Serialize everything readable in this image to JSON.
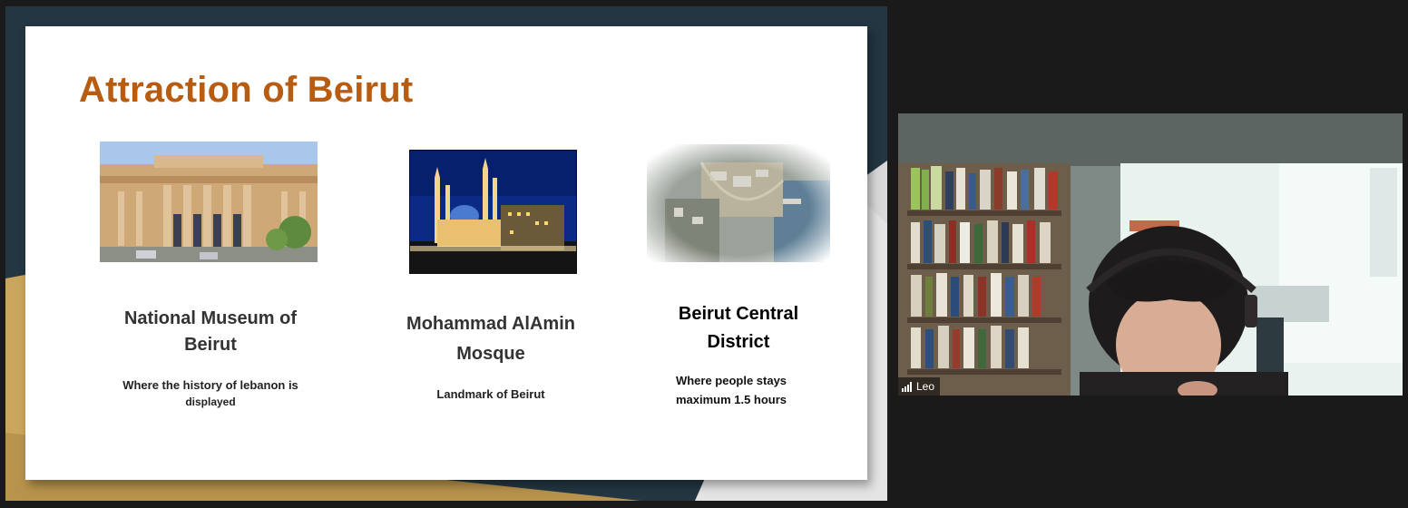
{
  "slide": {
    "title": "Attraction of Beirut",
    "items": [
      {
        "title_line1": "National Museum of",
        "title_line2": "Beirut",
        "desc_line1": "Where the history of  lebanon is",
        "desc_line2": "displayed",
        "image_icon": "museum-photo"
      },
      {
        "title_line1": "Mohammad AlAmin",
        "title_line2": "Mosque",
        "desc_line1": "Landmark of Beirut",
        "image_icon": "mosque-photo"
      },
      {
        "title_line1": "Beirut Central",
        "title_line2": "District",
        "desc_line1": "Where people stays",
        "desc_line2": "maximum 1.5 hours",
        "image_icon": "aerial-map-photo"
      }
    ],
    "colors": {
      "title": "#b85c12",
      "background_dark": "#233642",
      "background_gold": "#caa55c"
    }
  },
  "participant": {
    "name": "Leo",
    "icon": "signal-strength-icon"
  }
}
